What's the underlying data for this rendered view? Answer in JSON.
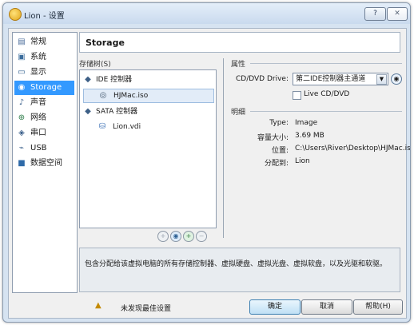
{
  "window": {
    "title": "Lion - 设置",
    "help_label": "?",
    "close_label": "✕"
  },
  "sidebar": {
    "items": [
      {
        "label": "常规",
        "icon": "general-icon"
      },
      {
        "label": "系统",
        "icon": "system-icon"
      },
      {
        "label": "显示",
        "icon": "display-icon"
      },
      {
        "label": "Storage",
        "icon": "storage-icon",
        "selected": true
      },
      {
        "label": "声音",
        "icon": "audio-icon"
      },
      {
        "label": "网络",
        "icon": "network-icon"
      },
      {
        "label": "串口",
        "icon": "serial-port-icon"
      },
      {
        "label": "USB",
        "icon": "usb-icon"
      },
      {
        "label": "数据空间",
        "icon": "shared-folders-icon"
      }
    ]
  },
  "page": {
    "title": "Storage"
  },
  "tree": {
    "caption": "存储树(S)",
    "controllers": [
      {
        "label": "IDE 控制器",
        "icon": "ide-controller-icon",
        "children": [
          {
            "label": "HJMac.iso",
            "icon": "optical-disc-icon",
            "selected": true
          }
        ]
      },
      {
        "label": "SATA 控制器",
        "icon": "sata-controller-icon",
        "children": [
          {
            "label": "Lion.vdi",
            "icon": "hard-disk-icon"
          }
        ]
      }
    ]
  },
  "attributes": {
    "caption": "属性",
    "drive_label": "CD/DVD Drive:",
    "drive_value": "第二IDE控制器主通道",
    "live_cd_label": "Live CD/DVD"
  },
  "details": {
    "caption": "明细",
    "rows": [
      {
        "label": "Type:",
        "value": "Image"
      },
      {
        "label": "容量大小:",
        "value": "3.69 MB"
      },
      {
        "label": "位置:",
        "value": "C:\\Users\\River\\Desktop\\HJMac.iso"
      },
      {
        "label": "分配到:",
        "value": "Lion"
      }
    ]
  },
  "description": "包含分配给该虚拟电脑的所有存储控制器、虚拟硬盘、虚拟光盘、虚拟软盘，以及光驱和软驱。",
  "status": {
    "warning_text": "未发现最佳设置"
  },
  "buttons": {
    "ok": "确定",
    "cancel": "取消",
    "help": "帮助(H)"
  },
  "colors": {
    "selection": "#3399ff",
    "window_frame": "#d6e3f1"
  }
}
